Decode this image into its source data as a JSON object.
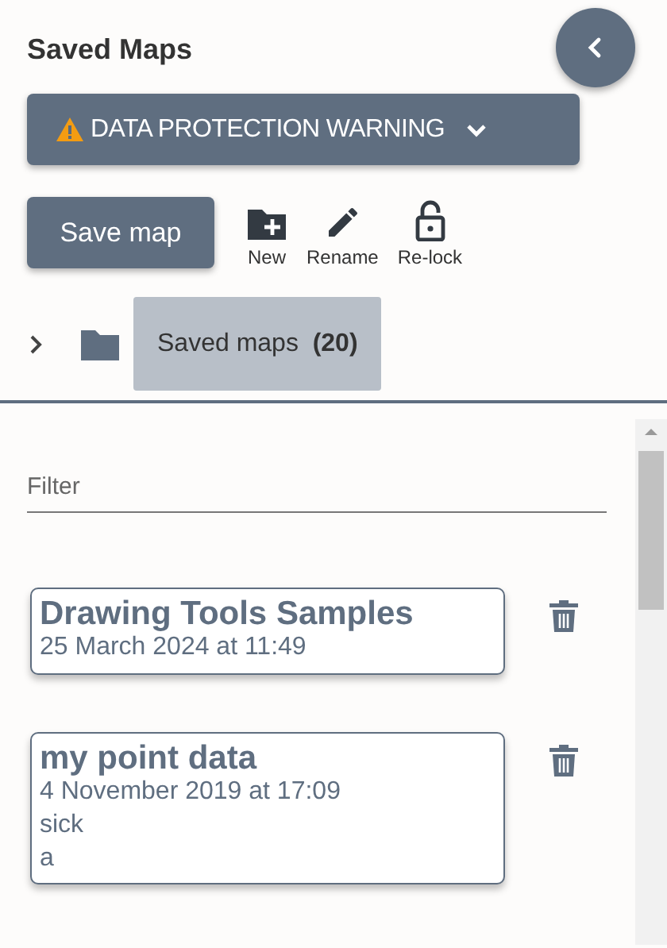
{
  "panel": {
    "title": "Saved Maps"
  },
  "warning": {
    "label": "DATA PROTECTION WARNING",
    "expanded": false
  },
  "toolbar": {
    "save_button": "Save map",
    "actions": [
      {
        "kind": "new",
        "label": "New"
      },
      {
        "kind": "rename",
        "label": "Rename"
      },
      {
        "kind": "relock",
        "label": "Re-lock"
      }
    ]
  },
  "folder": {
    "label": "Saved maps",
    "count": "(20)",
    "expanded": false,
    "selected": true
  },
  "filter": {
    "placeholder": "Filter"
  },
  "maps": [
    {
      "name": "Drawing Tools Samples",
      "date": "25 March 2024 at 11:49"
    },
    {
      "name": "my point data",
      "date": "4 November 2019 at 17:09",
      "notes": [
        "sick",
        "a"
      ]
    }
  ]
}
